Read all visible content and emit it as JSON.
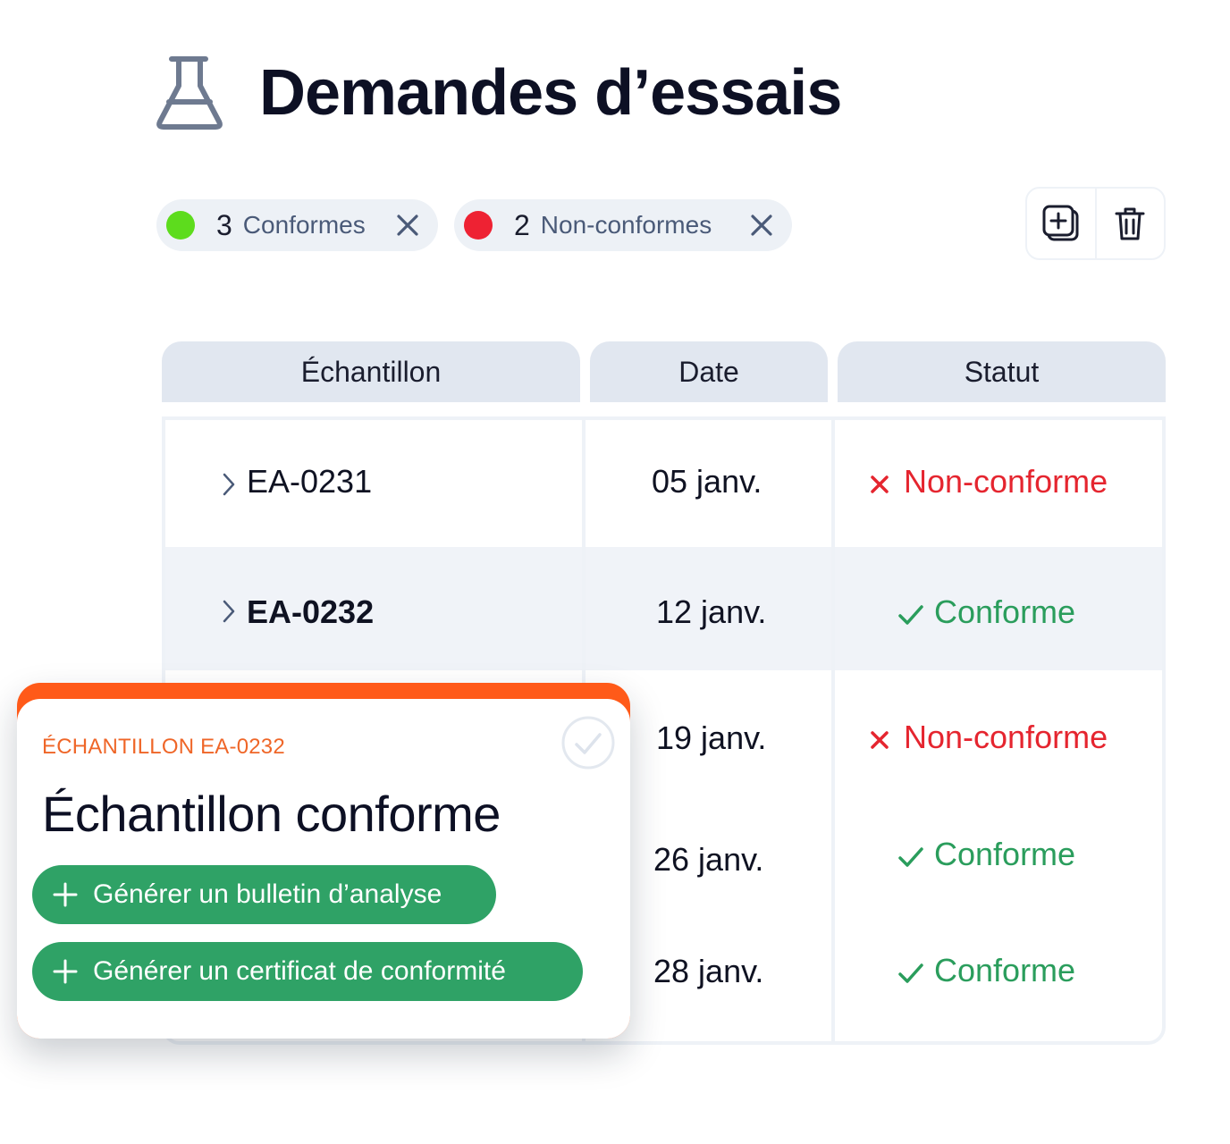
{
  "page": {
    "title": "Demandes d’essais",
    "icon": "flask-icon"
  },
  "filters": [
    {
      "count": "3",
      "label": "Conformes",
      "color": "#5ddc1d"
    },
    {
      "count": "2",
      "label": "Non-conformes",
      "color": "#ee2233"
    }
  ],
  "toolbar": {
    "add_icon": "add-copy-icon",
    "delete_icon": "trash-icon"
  },
  "table": {
    "columns": [
      "Échantillon",
      "Date",
      "Statut"
    ],
    "rows": [
      {
        "sample": "EA-0231",
        "date": "05 janv.",
        "status": "Non-conforme"
      },
      {
        "sample": "EA-0232",
        "date": "12 janv.",
        "status": "Conforme"
      },
      {
        "sample": "",
        "date": "19 janv.",
        "status": "Non-conforme"
      },
      {
        "sample": "",
        "date": "26 janv.",
        "status": "Conforme"
      },
      {
        "sample": "",
        "date": "28 janv.",
        "status": "Conforme"
      }
    ]
  },
  "popup": {
    "eyebrow": "ÉCHANTILLON EA-0232",
    "title": "Échantillon conforme",
    "actions": [
      "Générer un bulletin d’analyse",
      "Générer un certificat de conformité"
    ]
  },
  "colors": {
    "accent": "#ff5a19",
    "conforme": "#2a9d5c",
    "non_conforme": "#e5252f",
    "header_bg": "#e1e7f0"
  }
}
